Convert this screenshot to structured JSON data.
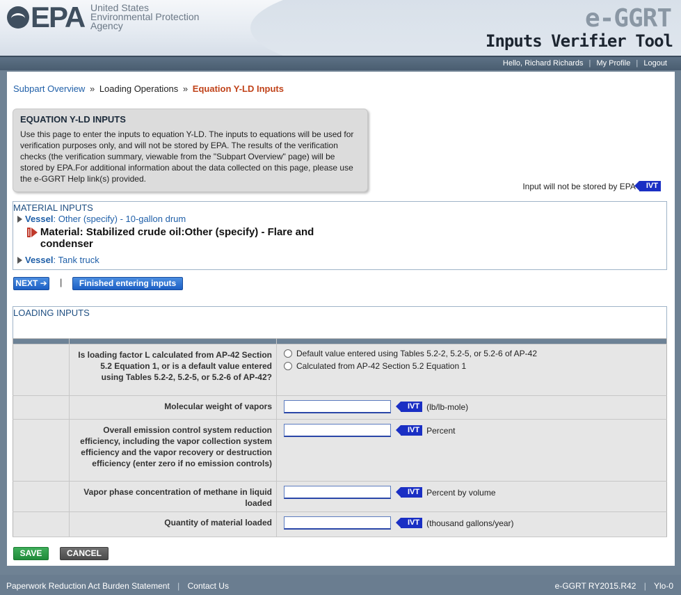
{
  "header": {
    "logo_text": "EPA",
    "agency_line1": "United States",
    "agency_line2": "Environmental Protection",
    "agency_line3": "Agency",
    "app_name": "e-GGRT",
    "app_subtitle": "Inputs Verifier Tool"
  },
  "userbar": {
    "greeting": "Hello, Richard Richards",
    "my_profile": "My Profile",
    "logout": "Logout",
    "separator": "|"
  },
  "breadcrumb": {
    "item1": "Subpart Overview",
    "sep": "»",
    "item2": "Loading Operations",
    "current": "Equation Y-LD Inputs"
  },
  "info": {
    "title": "EQUATION Y-LD INPUTS",
    "body": "Use this page to enter the inputs to equation Y-LD. The inputs to equations will be used for verification purposes only, and will not be stored by EPA. The results of the verification checks (the verification summary, viewable from the \"Subpart Overview\" page) will be stored by EPA.For additional information about the data collected on this page, please use the e-GGRT Help link(s) provided."
  },
  "ivt_note": {
    "text": "Input will not be stored by EPA",
    "tag": "IVT"
  },
  "material_inputs": {
    "title": "MATERIAL INPUTS",
    "vessel1_label": "Vessel",
    "vessel1_value": ": Other (specify) - 10-gallon drum",
    "material_label": "Material",
    "material_value": ": Stabilized crude oil:Other (specify) - Flare and condenser",
    "vessel2_label": "Vessel",
    "vessel2_value": ": Tank truck"
  },
  "buttons": {
    "next": "NEXT",
    "pipe": "|",
    "finished": "Finished entering inputs",
    "save": "SAVE",
    "cancel": "CANCEL"
  },
  "loading_inputs": {
    "title": "LOADING INPUTS",
    "rows": [
      {
        "label": "Is loading factor L calculated from AP-42 Section 5.2 Equation 1, or is a default value entered using Tables 5.2-2, 5.2-5, or 5.2-6 of AP-42?",
        "options": [
          "Default value entered using Tables 5.2-2, 5.2-5, or 5.2-6 of AP-42",
          "Calculated from AP-42 Section 5.2 Equation 1"
        ]
      },
      {
        "label": "Molecular weight of vapors",
        "value": "",
        "unit": "(lb/lb-mole)",
        "tag": "IVT"
      },
      {
        "label": "Overall emission control system reduction efficiency, including the vapor collection system efficiency and the vapor recovery or destruction efficiency (enter zero if no emission controls)",
        "value": "",
        "unit": "Percent",
        "tag": "IVT"
      },
      {
        "label": "Vapor phase concentration of methane in liquid loaded",
        "value": "",
        "unit": "Percent by volume",
        "tag": "IVT"
      },
      {
        "label": "Quantity of material loaded",
        "value": "",
        "unit": "(thousand gallons/year)",
        "tag": "IVT"
      }
    ]
  },
  "footer": {
    "paperwork": "Paperwork Reduction Act Burden Statement",
    "contact": "Contact Us",
    "version": "e-GGRT RY2015.R42",
    "code": "Ylo-0",
    "separator": "|"
  },
  "colors": {
    "link": "#1f5fa8",
    "current_crumb": "#c0431a",
    "ivt_tag": "#1a2fc4",
    "save": "#1f8a3a",
    "cancel": "#4a4a4a"
  }
}
